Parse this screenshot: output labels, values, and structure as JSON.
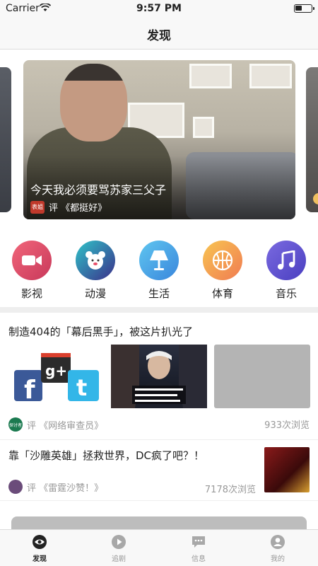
{
  "status_bar": {
    "carrier": "Carrier",
    "time": "9:57 PM"
  },
  "nav": {
    "title": "发现"
  },
  "banner": {
    "title": "今天我必须要骂苏家三父子",
    "badge": "表姐",
    "source": "评 《都挺好》"
  },
  "categories": [
    {
      "label": "影视",
      "icon": "video-camera-icon",
      "color": "#e8506a"
    },
    {
      "label": "动漫",
      "icon": "bear-icon",
      "color": "#2fb5c6"
    },
    {
      "label": "生活",
      "icon": "lamp-icon",
      "color": "#45a8e8"
    },
    {
      "label": "体育",
      "icon": "basketball-icon",
      "color": "#f6a04d"
    },
    {
      "label": "音乐",
      "icon": "music-note-icon",
      "color": "#6a5ad8"
    }
  ],
  "feed": [
    {
      "headline": "制造404的「幕后黑手」，被这片扒光了",
      "source": "评 《网络审查员》",
      "views": "933次浏览",
      "avatar_text": "探讨者",
      "avatar_color": "#1b7a50"
    },
    {
      "headline": "靠「沙雕英雄」拯救世界，DC疯了吧？！",
      "source": "评 《雷霆沙赞！》",
      "views": "7178次浏览",
      "avatar_color": "#6b4c7a"
    }
  ],
  "tabs": [
    {
      "label": "发现",
      "icon": "eye-icon",
      "active": true
    },
    {
      "label": "追剧",
      "icon": "play-circle-icon",
      "active": false
    },
    {
      "label": "信息",
      "icon": "chat-bubble-icon",
      "active": false
    },
    {
      "label": "我的",
      "icon": "user-icon",
      "active": false
    }
  ]
}
